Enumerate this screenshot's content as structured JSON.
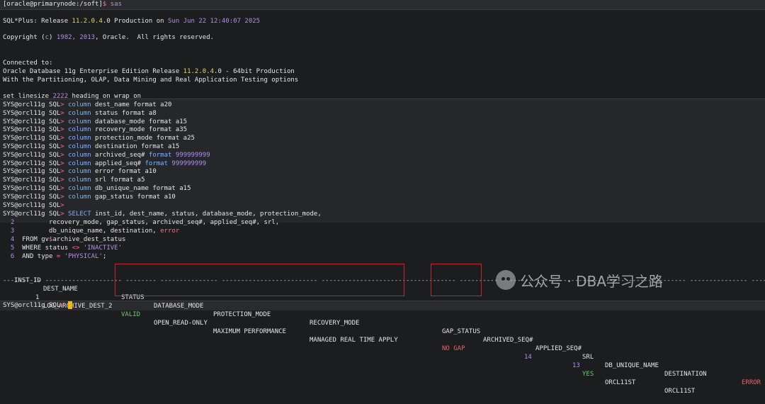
{
  "colors": {
    "prompt_yellow": "#e3d36b",
    "keyword_purple": "#b48ee8",
    "valid_green": "#6dcc6d",
    "error_red": "#e06a6a",
    "cursor": "#f5b800",
    "box_red": "#c0282e"
  },
  "shell": {
    "prompt_user": "[oracle@primarynode:/soft]",
    "prompt_sign": "$",
    "command": " sas"
  },
  "banner": {
    "pre": "SQL*Plus: Release ",
    "version": "11.2.0.4",
    "post": ".0 Production on ",
    "date": "Sun Jun 22 12:40:07 2025",
    "copyright_pre": "Copyright (",
    "copyright_c": "c",
    "copyright_mid": ") ",
    "copyright_years": "1982, 2013",
    "copyright_post": ", Oracle.  All rights reserved.",
    "connected": "Connected to:",
    "db_pre": "Oracle Database 11g Enterprise Edition Release ",
    "db_version": "11.2.0.4",
    "db_post": ".0 - 64bit Production",
    "options": "With the Partitioning, OLAP, Data Mining and Real Application Testing options"
  },
  "set_cmd": {
    "pre": "set linesize ",
    "num": "2222",
    "post": " heading on wrap on"
  },
  "sql_prompt": "SYS@orcl11g SQL",
  "column_cmds": [
    "dest_name format a20",
    "status format a8",
    "database_mode format a15",
    "recovery_mode format a35",
    "protection_mode format a25",
    "destination format a15",
    "archived_seq# format 999999999",
    "applied_seq# format 999999999",
    "error format a10",
    "srl format a5",
    "db_unique_name format a15",
    "gap_status format a10"
  ],
  "query": {
    "l1": "inst_id, dest_name, status, database_mode, protection_mode,",
    "l2": "recovery_mode, gap_status, archived_seq#, applied_seq#, srl,",
    "l3": "db_unique_name, destination, ",
    "l3_kw": "error",
    "l4_from": "FROM gv",
    "l4_dollar": "$",
    "l4_rest": "archive_dest_status",
    "l5_pre": "WHERE status ",
    "l5_op": "<>",
    "l5_val": "'INACTIVE'",
    "l6_pre": "AND type ",
    "l6_op": "=",
    "l6_val": "'PHYSICAL'",
    "l6_end": ";"
  },
  "result": {
    "headers": {
      "inst_id": "INST_ID",
      "dest_name": "DEST_NAME",
      "status": "STATUS",
      "database_mode": "DATABASE_MODE",
      "protection_mode": "PROTECTION_MODE",
      "recovery_mode": "RECOVERY_MODE",
      "gap_status": "GAP_STATUS",
      "archived_seq": "ARCHIVED_SEQ#",
      "applied_seq": "APPLIED_SEQ#",
      "srl": "SRL",
      "db_unique_name": "DB_UNIQUE_NAME",
      "destination": "DESTINATION",
      "error": "ERROR"
    },
    "dashes": "---------- -------------------- -------- --------------- ------------------------- ----------------------------------- ---------- ------------- ------------ ----- --------------- --------------- ----------",
    "row": {
      "inst_id": "1",
      "dest_name": "LOG_ARCHIVE_DEST_2",
      "status": "VALID",
      "database_mode": "OPEN_READ-ONLY",
      "protection_mode": "MAXIMUM PERFORMANCE",
      "recovery_mode": "MANAGED REAL TIME APPLY",
      "gap_status": "NO GAP",
      "archived_seq": "14",
      "applied_seq": "13",
      "srl": "YES",
      "db_unique_name": "ORCL11ST",
      "destination": "ORCL11ST"
    }
  },
  "final_prompt": "SYS@orcl11g SQL",
  "watermark": {
    "text": "公众号 · DBA学习之路",
    "icon": "wechat-icon"
  }
}
